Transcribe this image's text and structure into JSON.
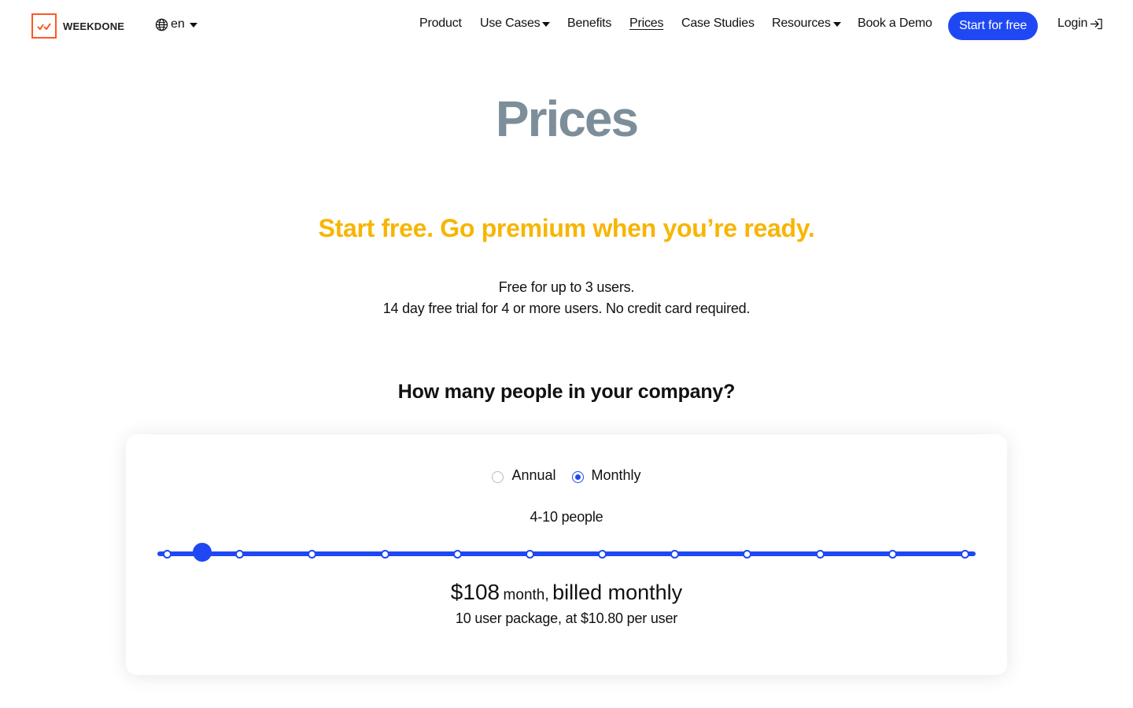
{
  "header": {
    "logo_text": "WEEKDONE",
    "language": "en",
    "nav": [
      {
        "label": "Product",
        "dropdown": false,
        "active": false
      },
      {
        "label": "Use Cases",
        "dropdown": true,
        "active": false
      },
      {
        "label": "Benefits",
        "dropdown": false,
        "active": false
      },
      {
        "label": "Prices",
        "dropdown": false,
        "active": true
      },
      {
        "label": "Case Studies",
        "dropdown": false,
        "active": false
      },
      {
        "label": "Resources",
        "dropdown": true,
        "active": false
      },
      {
        "label": "Book a Demo",
        "dropdown": false,
        "active": false
      }
    ],
    "cta_label": "Start for free",
    "login_label": "Login"
  },
  "hero": {
    "title": "Prices",
    "tagline": "Start free. Go premium when you’re ready.",
    "free_line": "Free for up to 3 users.",
    "trial_line": "14 day free trial for 4 or more users. No credit card required."
  },
  "pricing": {
    "question": "How many people in your company?",
    "billing_options": [
      {
        "label": "Annual",
        "selected": false
      },
      {
        "label": "Monthly",
        "selected": true
      }
    ],
    "people_range": "4-10 people",
    "slider": {
      "steps": 12,
      "selected_index": 1
    },
    "price": "$108",
    "price_unit": "month,",
    "billed": "billed monthly",
    "per_user_line": "10 user package, at $10.80 per user"
  },
  "colors": {
    "accent": "#1f48f4",
    "tagline": "#f7b500",
    "title": "#7c8e99",
    "logo": "#ff5722"
  },
  "icons": {
    "language": "globe-icon",
    "login": "login-icon",
    "logo": "weekdone-logo-icon"
  }
}
